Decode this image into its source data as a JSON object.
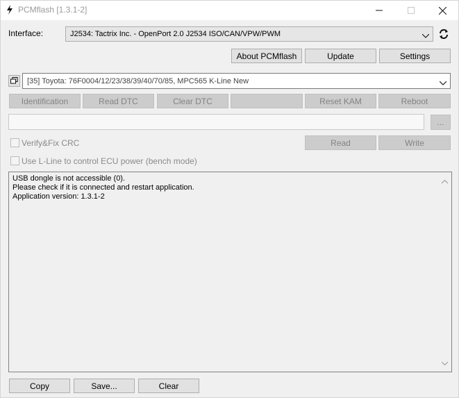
{
  "window": {
    "title": "PCMflash [1.3.1-2]",
    "icon": "lightning-bolt-icon"
  },
  "interface": {
    "label": "Interface:",
    "selected": "J2534: Tactrix Inc. - OpenPort 2.0 J2534 ISO/CAN/VPW/PWM",
    "refresh_icon": "refresh-icon"
  },
  "toolbar": {
    "about_label": "About PCMflash",
    "update_label": "Update",
    "settings_label": "Settings"
  },
  "ecu": {
    "selected": "[35] Toyota: 76F0004/12/23/38/39/40/70/85, MPC565 K-Line New",
    "window_icon": "restore-window-icon"
  },
  "actions": {
    "identification": "Identification",
    "read_dtc": "Read DTC",
    "clear_dtc": "Clear DTC",
    "blank": "",
    "reset_kam": "Reset KAM",
    "reboot": "Reboot"
  },
  "file": {
    "path": "",
    "browse_label": "..."
  },
  "options": {
    "verify_crc_label": "Verify&Fix CRC",
    "lline_label": "Use L-Line to control ECU power (bench mode)",
    "read_label": "Read",
    "write_label": "Write"
  },
  "log": {
    "lines": [
      "USB dongle is not accessible (0).",
      "Please check if it is connected and restart application.",
      "Application version: 1.3.1-2"
    ]
  },
  "bottom": {
    "copy_label": "Copy",
    "save_label": "Save...",
    "clear_label": "Clear"
  }
}
